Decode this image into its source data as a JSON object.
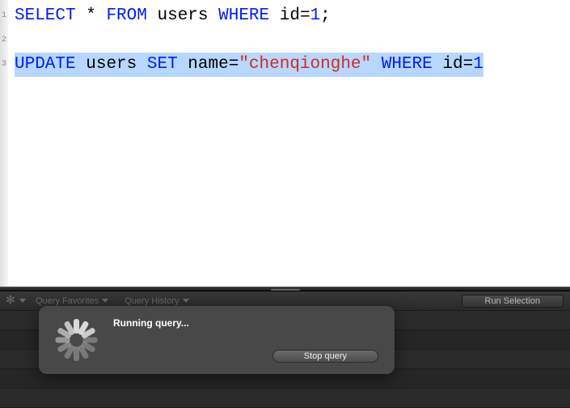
{
  "editor": {
    "lines": [
      {
        "tokens": [
          {
            "t": "kw",
            "v": "SELECT"
          },
          {
            "t": "sp",
            "v": " "
          },
          {
            "t": "op",
            "v": "*"
          },
          {
            "t": "sp",
            "v": " "
          },
          {
            "t": "kw",
            "v": "FROM"
          },
          {
            "t": "sp",
            "v": " "
          },
          {
            "t": "id",
            "v": "users"
          },
          {
            "t": "sp",
            "v": " "
          },
          {
            "t": "kw",
            "v": "WHERE"
          },
          {
            "t": "sp",
            "v": " "
          },
          {
            "t": "id",
            "v": "id"
          },
          {
            "t": "op",
            "v": "="
          },
          {
            "t": "num",
            "v": "1"
          },
          {
            "t": "op",
            "v": ";"
          }
        ],
        "selected": false
      },
      {
        "tokens": [],
        "selected": false
      },
      {
        "tokens": [
          {
            "t": "kw",
            "v": "UPDATE"
          },
          {
            "t": "sp",
            "v": " "
          },
          {
            "t": "id",
            "v": "users"
          },
          {
            "t": "sp",
            "v": " "
          },
          {
            "t": "kw",
            "v": "SET"
          },
          {
            "t": "sp",
            "v": " "
          },
          {
            "t": "id",
            "v": "name"
          },
          {
            "t": "op",
            "v": "="
          },
          {
            "t": "str",
            "v": "\"chenqionghe\""
          },
          {
            "t": "sp",
            "v": " "
          },
          {
            "t": "kw",
            "v": "WHERE"
          },
          {
            "t": "sp",
            "v": " "
          },
          {
            "t": "id",
            "v": "id"
          },
          {
            "t": "op",
            "v": "="
          },
          {
            "t": "num",
            "v": "1"
          }
        ],
        "selected": true
      }
    ],
    "line_numbers": [
      "1",
      "2",
      "3"
    ]
  },
  "toolbar": {
    "favorites_label": "Query Favorites",
    "history_label": "Query History",
    "run_label": "Run Selection"
  },
  "overlay": {
    "title": "Running query...",
    "stop_label": "Stop query"
  },
  "colors": {
    "keyword": "#0019ff",
    "string": "#ce2b1d",
    "selection": "#b7d7ff"
  }
}
